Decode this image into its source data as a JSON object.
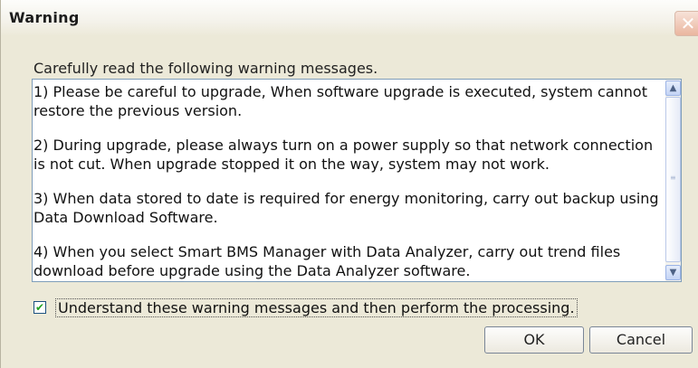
{
  "dialog": {
    "title": "Warning",
    "close_glyph": "✕",
    "instruction": "Carefully read the following warning messages.",
    "messages": [
      "1) Please be careful to upgrade, When software upgrade is executed, system cannot restore the previous version.",
      "2) During upgrade, please always turn on a power supply so that network connection is not cut. When upgrade stopped it on the way, system may not work.",
      "3) When data stored to date is required for energy monitoring, carry out backup using Data Download Software.",
      "4) When you select Smart BMS Manager with Data Analyzer, carry out trend files download before upgrade using the Data Analyzer software."
    ],
    "checkbox": {
      "label": "Understand these warning messages and then perform the processing.",
      "checked": true
    },
    "buttons": {
      "ok": "OK",
      "cancel": "Cancel"
    }
  },
  "icons": {
    "close": "close-icon",
    "scroll_up": "chevron-up-icon",
    "scroll_down": "chevron-down-icon",
    "check": "check-icon"
  },
  "colors": {
    "dialog_bg": "#ece9d8",
    "border": "#7f9db9",
    "checkmark": "#21a121"
  }
}
